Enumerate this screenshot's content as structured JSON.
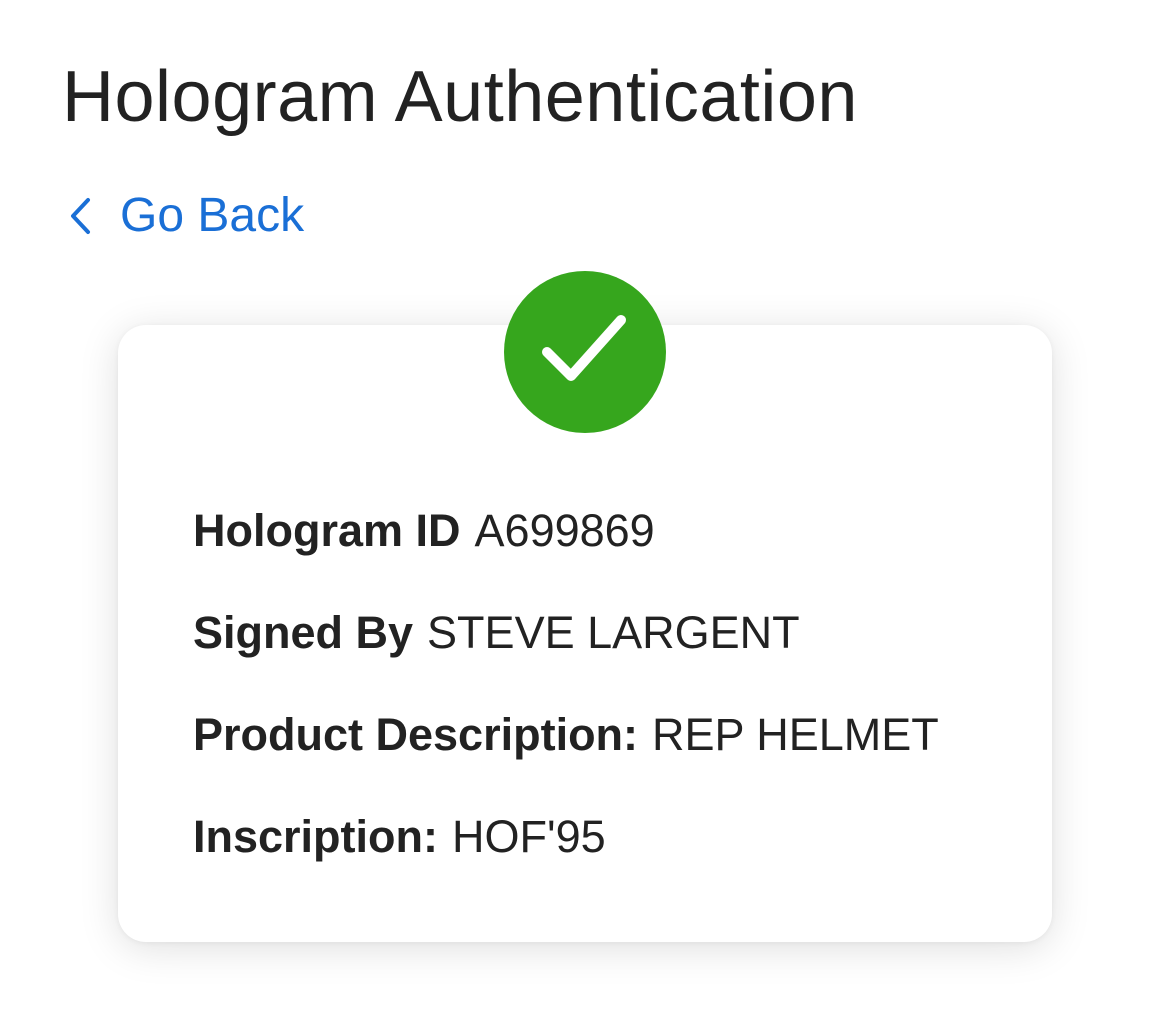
{
  "page": {
    "title": "Hologram Authentication",
    "back_label": "Go Back"
  },
  "status": {
    "icon": "checkmark-icon",
    "color": "#36a61d"
  },
  "details": [
    {
      "label": "Hologram ID",
      "value": "A699869"
    },
    {
      "label": "Signed By",
      "value": "STEVE LARGENT"
    },
    {
      "label": "Product Description:",
      "value": "REP HELMET"
    },
    {
      "label": "Inscription:",
      "value": "HOF'95"
    }
  ],
  "colors": {
    "link": "#1a6fd6",
    "text": "#222222",
    "success": "#36a61d"
  }
}
